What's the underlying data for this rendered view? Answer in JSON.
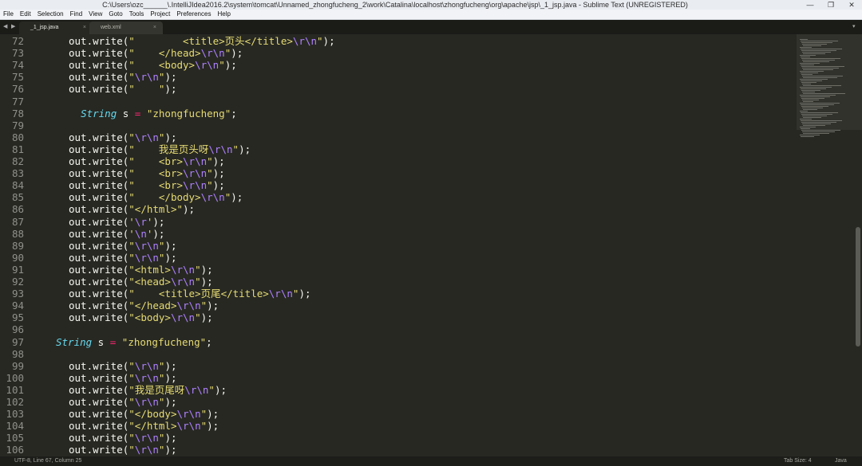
{
  "window": {
    "title": "C:\\Users\\ozc______\\.IntelliJIdea2016.2\\system\\tomcat\\Unnamed_zhongfucheng_2\\work\\Catalina\\localhost\\zhongfucheng\\org\\apache\\jsp\\_1_jsp.java - Sublime Text (UNREGISTERED)",
    "minimize_glyph": "—",
    "maximize_glyph": "❐",
    "close_glyph": "✕"
  },
  "menu": [
    "File",
    "Edit",
    "Selection",
    "Find",
    "View",
    "Goto",
    "Tools",
    "Project",
    "Preferences",
    "Help"
  ],
  "tabs": [
    {
      "label": "_1_jsp.java",
      "close": "×",
      "active": true
    },
    {
      "label": "web.xml",
      "close": "×",
      "active": false
    }
  ],
  "nav": {
    "left": "◀",
    "right": "▶",
    "more": "▾"
  },
  "lines": [
    {
      "n": "72",
      "c": "out.write(\"        <title>页头</title>\\r\\n\");"
    },
    {
      "n": "73",
      "c": "out.write(\"    </head>\\r\\n\");"
    },
    {
      "n": "74",
      "c": "out.write(\"    <body>\\r\\n\");"
    },
    {
      "n": "75",
      "c": "out.write(\"\\r\\n\");"
    },
    {
      "n": "76",
      "c": "out.write(\"    \");"
    },
    {
      "n": "77",
      "c": ""
    },
    {
      "n": "78",
      "c": "  String s = \"zhongfucheng\";"
    },
    {
      "n": "79",
      "c": ""
    },
    {
      "n": "80",
      "c": "out.write(\"\\r\\n\");"
    },
    {
      "n": "81",
      "c": "out.write(\"    我是页头呀\\r\\n\");"
    },
    {
      "n": "82",
      "c": "out.write(\"    <br>\\r\\n\");"
    },
    {
      "n": "83",
      "c": "out.write(\"    <br>\\r\\n\");"
    },
    {
      "n": "84",
      "c": "out.write(\"    <br>\\r\\n\");"
    },
    {
      "n": "85",
      "c": "out.write(\"    </body>\\r\\n\");"
    },
    {
      "n": "86",
      "c": "out.write(\"</html>\");"
    },
    {
      "n": "87",
      "c": "out.write('\\r');"
    },
    {
      "n": "88",
      "c": "out.write('\\n');"
    },
    {
      "n": "89",
      "c": "out.write(\"\\r\\n\");"
    },
    {
      "n": "90",
      "c": "out.write(\"\\r\\n\");"
    },
    {
      "n": "91",
      "c": "out.write(\"<html>\\r\\n\");"
    },
    {
      "n": "92",
      "c": "out.write(\"<head>\\r\\n\");"
    },
    {
      "n": "93",
      "c": "out.write(\"    <title>页尾</title>\\r\\n\");"
    },
    {
      "n": "94",
      "c": "out.write(\"</head>\\r\\n\");"
    },
    {
      "n": "95",
      "c": "out.write(\"<body>\\r\\n\");"
    },
    {
      "n": "96",
      "c": ""
    },
    {
      "n": "97",
      "c": "String s = \"zhongfucheng\";",
      "outdent": true
    },
    {
      "n": "98",
      "c": ""
    },
    {
      "n": "99",
      "c": "out.write(\"\\r\\n\");"
    },
    {
      "n": "100",
      "c": "out.write(\"\\r\\n\");"
    },
    {
      "n": "101",
      "c": "out.write(\"我是页尾呀\\r\\n\");"
    },
    {
      "n": "102",
      "c": "out.write(\"\\r\\n\");"
    },
    {
      "n": "103",
      "c": "out.write(\"</body>\\r\\n\");"
    },
    {
      "n": "104",
      "c": "out.write(\"</html>\\r\\n\");"
    },
    {
      "n": "105",
      "c": "out.write(\"\\r\\n\");"
    },
    {
      "n": "106",
      "c": "out.write(\"\\r\\n\");"
    }
  ],
  "status": {
    "left": "UTF-8, Line 67, Column 25",
    "tab_size": "Tab Size: 4",
    "syntax": "Java"
  },
  "colors": {
    "background": "#272822",
    "string": "#e6db74",
    "escape": "#ae81ff",
    "type": "#66d9ef",
    "operator": "#f92672"
  }
}
